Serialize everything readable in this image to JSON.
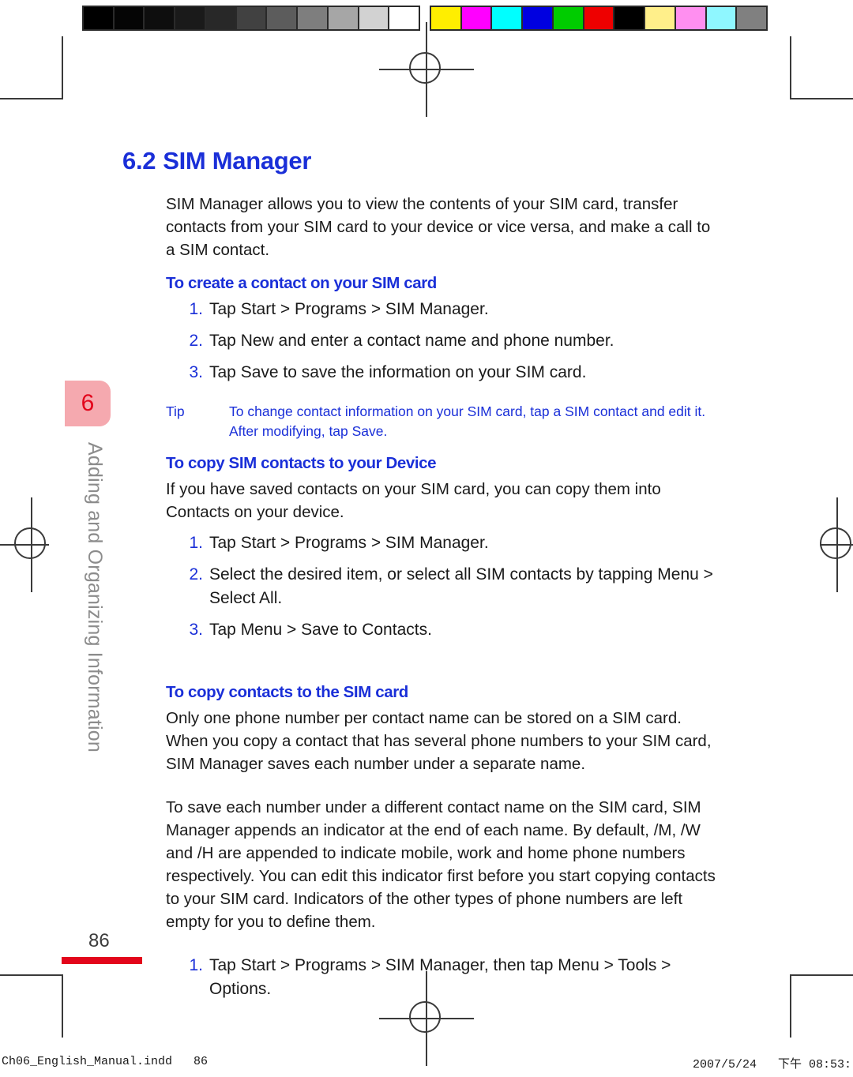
{
  "document": {
    "page_number": "86",
    "chapter_number": "6",
    "chapter_title": "Adding and Organizing Information"
  },
  "section": {
    "number": "6.2",
    "title": "SIM Manager",
    "intro": "SIM Manager allows you to view the contents of your SIM card, transfer contacts from your SIM card to your device or vice versa, and make a call to a SIM contact."
  },
  "subsections": [
    {
      "heading": "To create a contact on your SIM card",
      "steps": [
        {
          "num": "1.",
          "text": "Tap Start > Programs > SIM Manager."
        },
        {
          "num": "2.",
          "text": "Tap New and enter a contact name and phone number."
        },
        {
          "num": "3.",
          "text": "Tap Save to save the information on your SIM card."
        }
      ]
    },
    {
      "heading": "To copy SIM contacts to your Device",
      "body": "If you have saved contacts on your SIM card, you can copy them into Contacts on your device.",
      "steps": [
        {
          "num": "1.",
          "text": "Tap Start > Programs > SIM Manager."
        },
        {
          "num": "2.",
          "text": "Select the desired item, or select all SIM contacts by tapping Menu > Select All."
        },
        {
          "num": "3.",
          "text": "Tap Menu > Save to Contacts."
        }
      ]
    },
    {
      "heading": "To copy contacts to the SIM card",
      "body1": "Only one phone number per contact name can be stored on a SIM card. When you copy a contact that has several phone numbers to your SIM card, SIM Manager saves each number under a separate name.",
      "body2": "To save each number under a different contact name on the SIM card, SIM Manager appends an indicator at the end of each name. By default, /M, /W and /H are appended to indicate mobile, work and home phone numbers respectively. You can edit this indicator first before you start copying contacts to your SIM card. Indicators of the other types of phone numbers are left empty for you to define them.",
      "steps": [
        {
          "num": "1.",
          "text": "Tap Start > Programs > SIM Manager, then tap Menu > Tools > Options."
        }
      ]
    }
  ],
  "tip": {
    "label": "Tip",
    "text": "To change contact information on your SIM card, tap a SIM contact and edit it. After modifying, tap Save."
  },
  "print_footer": {
    "file_name": "Ch06_English_Manual.indd   86",
    "timestamp": "2007/5/24   下午 08:53:"
  },
  "colors": {
    "heading_blue": "#1a2fd8",
    "tab_pink": "#f5a9af",
    "tab_number_red": "#e3051b",
    "rule_red": "#e3051b",
    "chapter_title_gray": "#8c8c8c",
    "body_black": "#1a1a1a"
  },
  "calibration": {
    "grayscale_swatches": [
      "#000000",
      "#050505",
      "#0e0e0e",
      "#1a1a1a",
      "#282828",
      "#414141",
      "#5c5c5c",
      "#7e7e7e",
      "#a6a6a6",
      "#d2d2d2",
      "#ffffff"
    ],
    "color_swatches": [
      "#ffee00",
      "#ff00ff",
      "#00ffff",
      "#0000e0",
      "#00cc00",
      "#ee0000",
      "#000000",
      "#ffef8a",
      "#ff8ff0",
      "#8ff7ff",
      "#808080"
    ]
  }
}
